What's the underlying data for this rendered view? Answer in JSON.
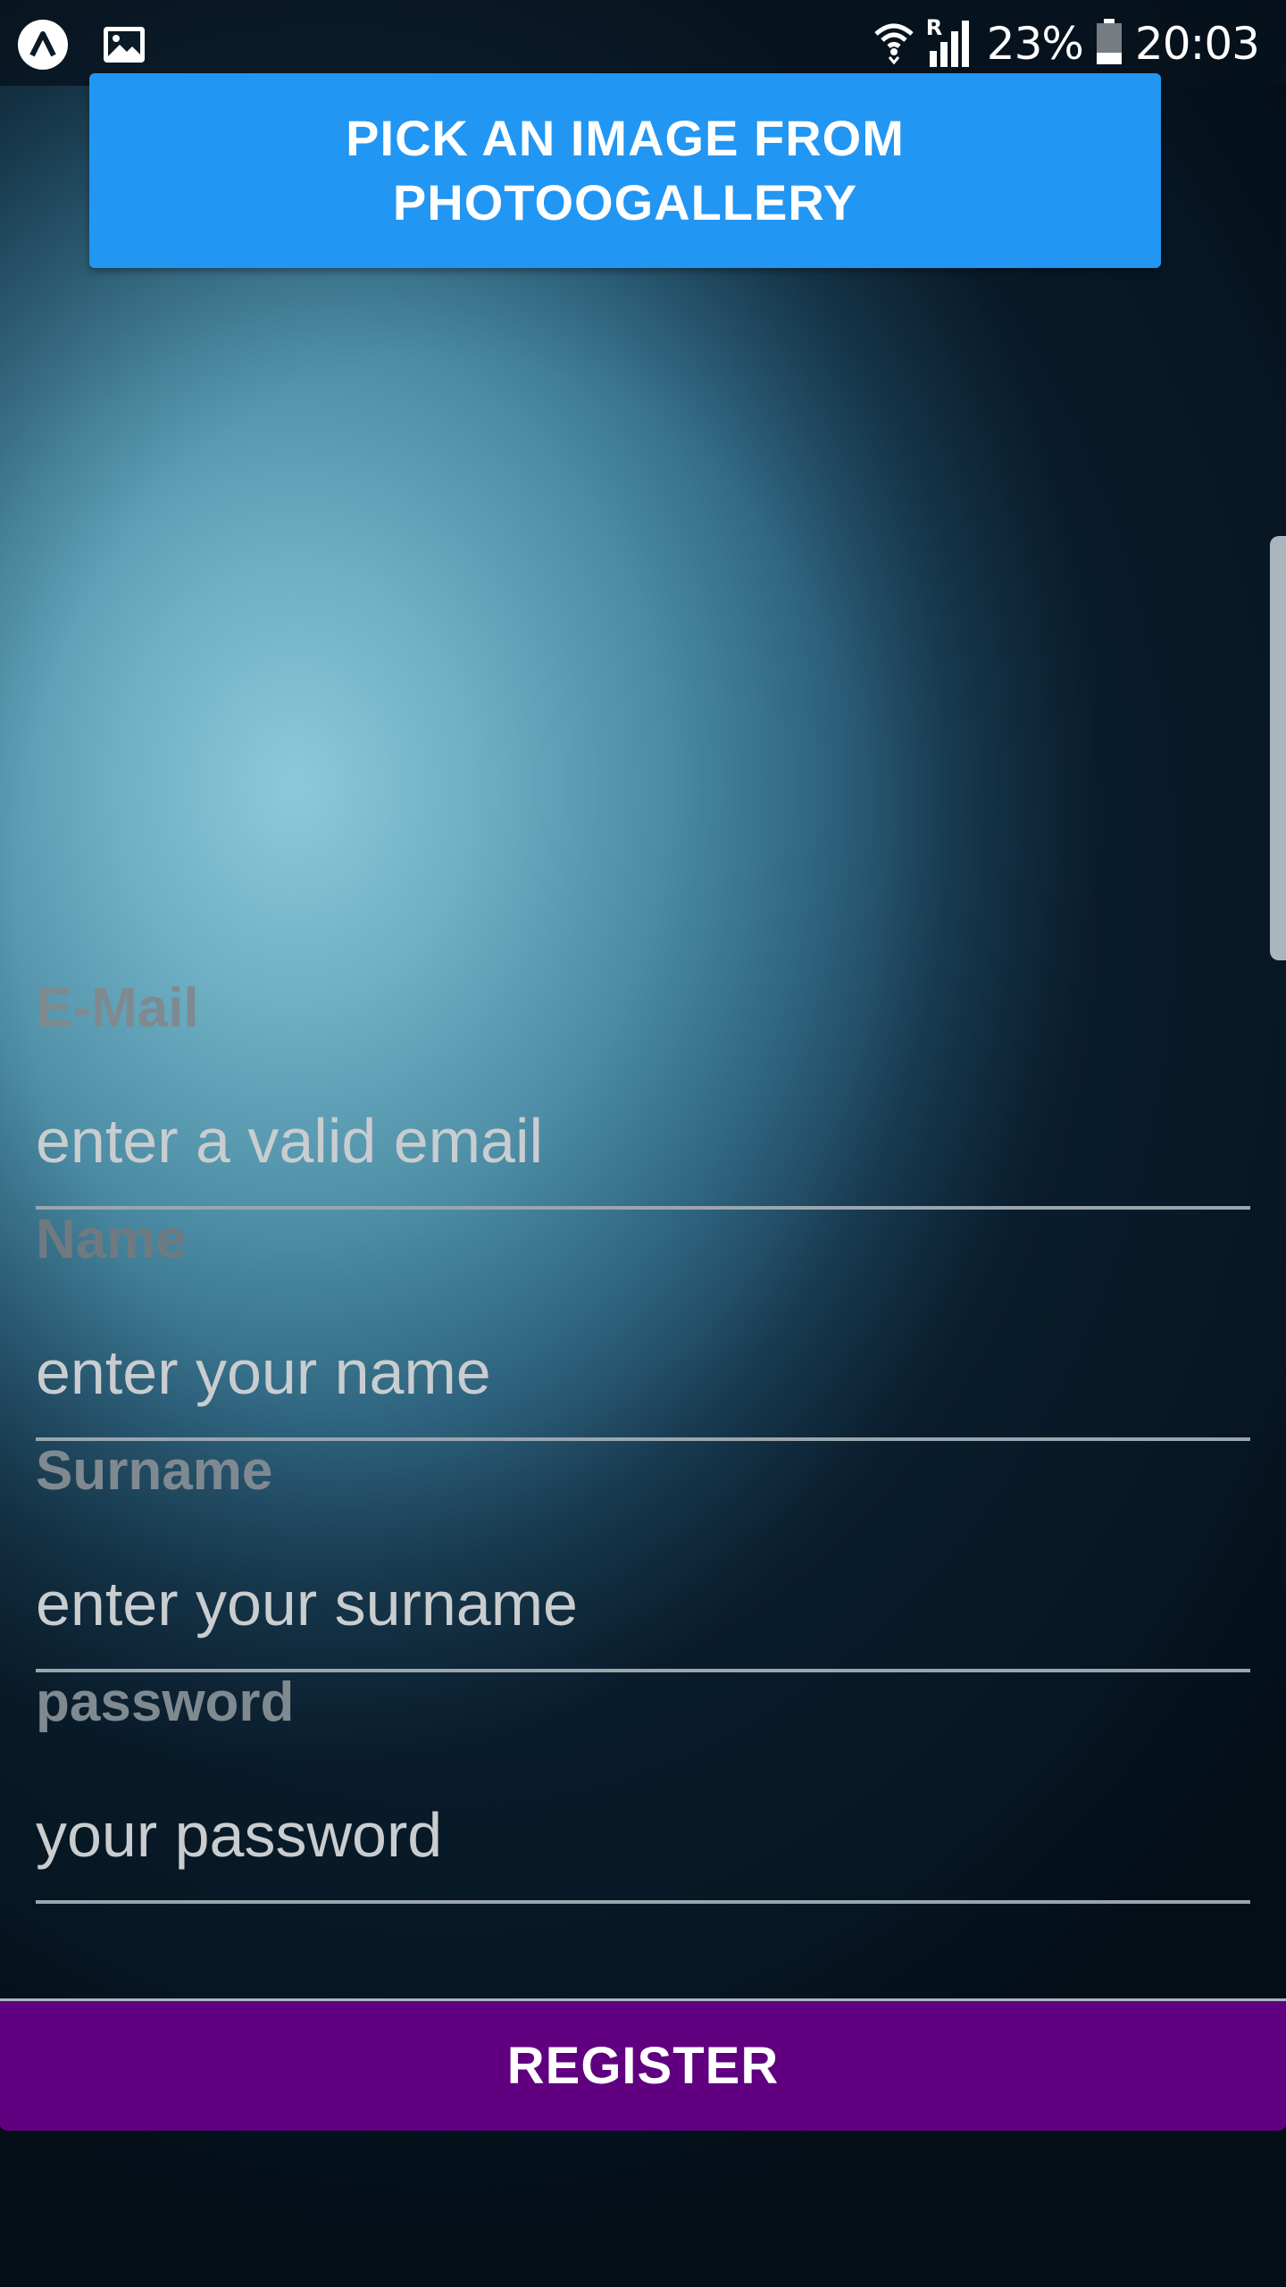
{
  "status_bar": {
    "left_icons": [
      "app-notification-icon",
      "image-notification-icon"
    ],
    "right_icons": [
      "wifi-icon",
      "signal-icon",
      "battery-icon"
    ],
    "roaming_indicator": "R",
    "battery": "23%",
    "time": "20:03"
  },
  "pick_image_button": {
    "label": "PICK AN IMAGE FROM PHOTOOGALLERY",
    "color": "#2196f3"
  },
  "form": {
    "email": {
      "label": "E-Mail",
      "value": "",
      "placeholder": "enter a valid email"
    },
    "name": {
      "label": "Name",
      "value": "",
      "placeholder": "enter your name"
    },
    "surname": {
      "label": "Surname",
      "value": "",
      "placeholder": "enter your surname"
    },
    "password": {
      "label": "password",
      "value": "",
      "placeholder": "your password"
    }
  },
  "register_button": {
    "label": "REGISTER",
    "color": "#600080"
  }
}
